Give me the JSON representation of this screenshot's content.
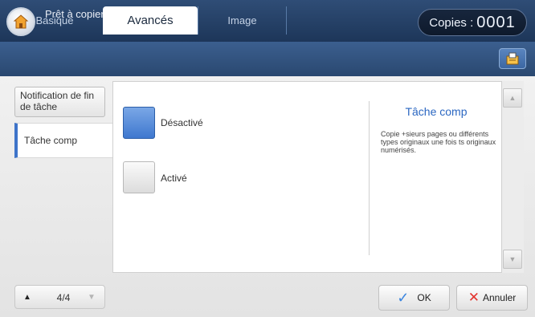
{
  "header": {
    "status_text": "Prêt à copier",
    "copies_label": "Copies :",
    "copies_value": "0001"
  },
  "tabs": [
    {
      "label": "Basique"
    },
    {
      "label": "Avancés"
    },
    {
      "label": "Image"
    }
  ],
  "sidebar": {
    "items": [
      {
        "label": "Notification de fin de tâche"
      },
      {
        "label": "Tâche comp"
      }
    ]
  },
  "options": [
    {
      "label": "Désactivé",
      "selected": true
    },
    {
      "label": "Activé",
      "selected": false
    }
  ],
  "info": {
    "title": "Tâche comp",
    "description": "Copie +sieurs pages ou différents types originaux une fois ts originaux numérisés."
  },
  "pager": {
    "text": "4/4"
  },
  "footer": {
    "ok_label": "OK",
    "cancel_label": "Annuler"
  },
  "colors": {
    "accent": "#3e74c9",
    "header_bg": "#2f4d76",
    "info_title": "#2b67c2",
    "cancel_x": "#e3342f"
  },
  "icons": {
    "home": "home-icon",
    "tab_side": "document-stack-icon",
    "ok": "check-icon",
    "cancel": "x-icon"
  }
}
